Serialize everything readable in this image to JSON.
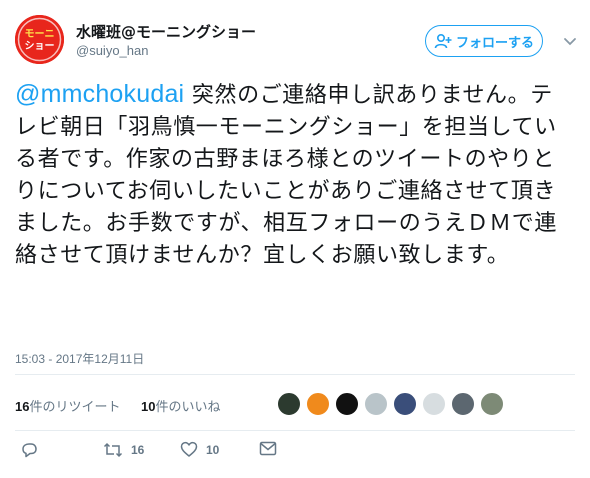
{
  "author": {
    "display_name": "水曜班@モーニングショー",
    "screen_name": "@suiyo_han",
    "avatar_text": "モーニングショー"
  },
  "follow_button": {
    "label": "フォローする",
    "icon": "add-person-icon"
  },
  "menu": {
    "icon": "chevron-down-icon"
  },
  "tweet": {
    "mention": "@mmchokudai",
    "body": " 突然のご連絡申し訳ありません。テレビ朝日「羽鳥慎一モーニングショー」を担当している者です。作家の古野まほろ様とのツイートのやりとりについてお伺いしたいことがありご連絡させて頂きました。お手数ですが、相互フォローのうえＤＭで連絡させて頂けませんか？宜しくお願い致します。"
  },
  "timestamp": "15:03 - 2017年12月11日",
  "stats": {
    "retweets_count": "16",
    "retweets_label": "件のリツイート",
    "likes_count": "10",
    "likes_label": "件のいいね"
  },
  "likers": [
    {
      "name": "liker-1",
      "color": "#2c3a2f"
    },
    {
      "name": "liker-2",
      "color": "#f08a1c"
    },
    {
      "name": "liker-3",
      "color": "#111111"
    },
    {
      "name": "liker-4",
      "color": "#b9c4c9"
    },
    {
      "name": "liker-5",
      "color": "#3a4e7a"
    },
    {
      "name": "liker-6",
      "color": "#d7dde0"
    },
    {
      "name": "liker-7",
      "color": "#5c6770"
    },
    {
      "name": "liker-8",
      "color": "#7d8a76"
    }
  ],
  "actions": {
    "reply_icon": "reply-icon",
    "retweet_icon": "retweet-icon",
    "retweet_count": "16",
    "like_icon": "heart-icon",
    "like_count": "10",
    "dm_icon": "envelope-icon"
  },
  "colors": {
    "accent": "#1da1f2",
    "secondary_text": "#657786",
    "divider": "#e6ecf0",
    "avatar_bg": "#e8261c"
  }
}
